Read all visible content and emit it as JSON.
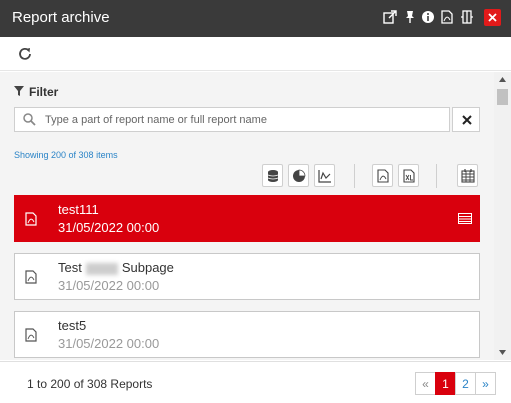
{
  "window": {
    "title": "Report archive",
    "close_label": "×",
    "icons": [
      "popout-icon",
      "pin-icon",
      "info-icon",
      "pdf-export-icon",
      "split-icon",
      "close-icon"
    ]
  },
  "toolbar": {
    "refresh_icon": "refresh-icon"
  },
  "filter": {
    "label": "Filter",
    "search_placeholder": "Type a part of report name or full report name",
    "search_value": ""
  },
  "summary": {
    "showing_text": "Showing 200 of 308 items"
  },
  "view_buttons": [
    "database-icon",
    "pie-chart-icon",
    "line-chart-icon",
    "pdf-icon",
    "xls-icon",
    "grid-icon"
  ],
  "reports": [
    {
      "name": "test111",
      "date": "31/05/2022 00:00",
      "selected": true
    },
    {
      "name_prefix": "Test",
      "name_suffix": "Subpage",
      "date": "31/05/2022 00:00",
      "selected": false
    },
    {
      "name": "test5",
      "date": "31/05/2022 00:00",
      "selected": false
    }
  ],
  "footer": {
    "count_text": "1 to 200 of 308 Reports",
    "pagination": {
      "prev": "«",
      "pages": [
        "1",
        "2"
      ],
      "current": "1",
      "next": "»"
    }
  },
  "colors": {
    "accent": "#d9000d",
    "titlebar": "#3a3a3a",
    "link": "#2b84c7"
  }
}
